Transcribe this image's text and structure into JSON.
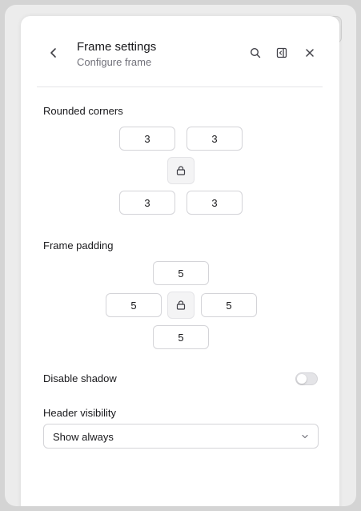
{
  "header": {
    "title": "Frame settings",
    "subtitle": "Configure frame",
    "back_icon": "chevron-left-icon",
    "search_icon": "search-icon",
    "sidebar_icon": "panel-left-icon",
    "close_icon": "close-icon"
  },
  "rounded_corners": {
    "label": "Rounded corners",
    "top_left": "3",
    "top_right": "3",
    "bottom_left": "3",
    "bottom_right": "3",
    "lock_icon": "lock-icon"
  },
  "frame_padding": {
    "label": "Frame padding",
    "top": "5",
    "left": "5",
    "right": "5",
    "bottom": "5",
    "lock_icon": "lock-icon"
  },
  "shadow": {
    "label": "Disable shadow",
    "enabled": false
  },
  "header_visibility": {
    "label": "Header visibility",
    "selected": "Show always",
    "chevron_icon": "chevron-down-icon"
  },
  "colors": {
    "background": "#d4d4d4",
    "panel": "#ffffff",
    "border": "#d4d4d8",
    "muted_text": "#71717a",
    "text": "#18181b"
  }
}
